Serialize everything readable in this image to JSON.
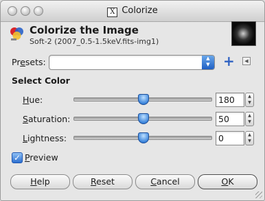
{
  "window": {
    "title": "Colorize"
  },
  "header": {
    "title": "Colorize the Image",
    "subtitle": "Soft-2 (2007_0.5-1.5keV.fits-img1)"
  },
  "presets": {
    "label_prefix": "Pr",
    "label_mnemonic": "e",
    "label_suffix": "sets:",
    "value": ""
  },
  "select_color": {
    "title": "Select Color",
    "rows": [
      {
        "mnemonic": "H",
        "rest": "ue:",
        "value": "180",
        "fraction": 0.5
      },
      {
        "mnemonic": "S",
        "rest": "aturation:",
        "value": "50",
        "fraction": 0.5
      },
      {
        "mnemonic": "L",
        "rest": "ightness:",
        "value": "0",
        "fraction": 0.5
      }
    ]
  },
  "preview": {
    "mnemonic": "P",
    "rest": "review",
    "checked": true
  },
  "buttons": {
    "help": {
      "mnemonic": "H",
      "rest": "elp"
    },
    "reset": {
      "mnemonic": "R",
      "rest": "eset"
    },
    "cancel": {
      "mnemonic": "C",
      "rest": "ancel"
    },
    "ok": {
      "mnemonic": "O",
      "rest": "K"
    }
  },
  "colors": {
    "accent": "#2c6fd0"
  }
}
